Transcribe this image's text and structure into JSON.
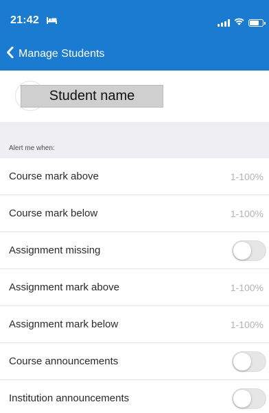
{
  "status_bar": {
    "time": "21:42",
    "sleep_icon": "bed-icon",
    "signal_icon": "cellular-signal-icon",
    "wifi_icon": "wifi-icon",
    "battery_icon": "battery-icon"
  },
  "nav": {
    "back_label": "Manage Students",
    "back_icon": "chevron-left-icon",
    "bar_color": "#1a7bd0"
  },
  "student": {
    "name": "Student name"
  },
  "section": {
    "label": "Alert me when:"
  },
  "rows": [
    {
      "label": "Course mark above",
      "type": "input",
      "placeholder": "1-100%"
    },
    {
      "label": "Course mark below",
      "type": "input",
      "placeholder": "1-100%"
    },
    {
      "label": "Assignment missing",
      "type": "toggle",
      "on": false
    },
    {
      "label": "Assignment mark above",
      "type": "input",
      "placeholder": "1-100%"
    },
    {
      "label": "Assignment mark below",
      "type": "input",
      "placeholder": "1-100%"
    },
    {
      "label": "Course announcements",
      "type": "toggle",
      "on": false
    },
    {
      "label": "Institution announcements",
      "type": "toggle",
      "on": false
    }
  ]
}
